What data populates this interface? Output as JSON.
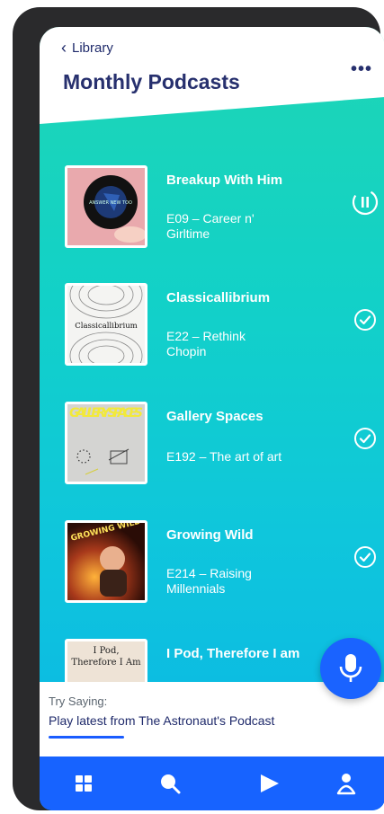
{
  "header": {
    "back_label": "Library",
    "title": "Monthly Podcasts"
  },
  "episodes": [
    {
      "title": "Breakup With Him",
      "subtitle": "E09 – Career n' Girltime",
      "status": "paused-icon",
      "art_text": "ANSWER NEW TOO"
    },
    {
      "title": "Classicallibrium",
      "subtitle": "E22 – Rethink Chopin",
      "status": "check-icon",
      "art_text": "Classicallibrium"
    },
    {
      "title": "Gallery Spaces",
      "subtitle": "E192 – The art of art",
      "status": "check-icon",
      "art_text": "GALLERY SPACES"
    },
    {
      "title": "Growing Wild",
      "subtitle": "E214 – Raising Millennials",
      "status": "check-icon",
      "art_text": "GROWING WILD"
    },
    {
      "title": "I Pod, Therefore I am",
      "subtitle": "",
      "status": "",
      "art_text": "I Pod, Therefore I Am"
    }
  ],
  "assistant": {
    "try_label": "Try Saying:",
    "phrase": "Play latest from The Astronaut's Podcast"
  },
  "nav": [
    "grid-icon",
    "search-icon",
    "play-icon",
    "profile-icon"
  ],
  "colors": {
    "accent": "#1763ff",
    "title": "#27306e",
    "gradient_top": "#1ed6b4",
    "gradient_bottom": "#0ab5e6"
  }
}
